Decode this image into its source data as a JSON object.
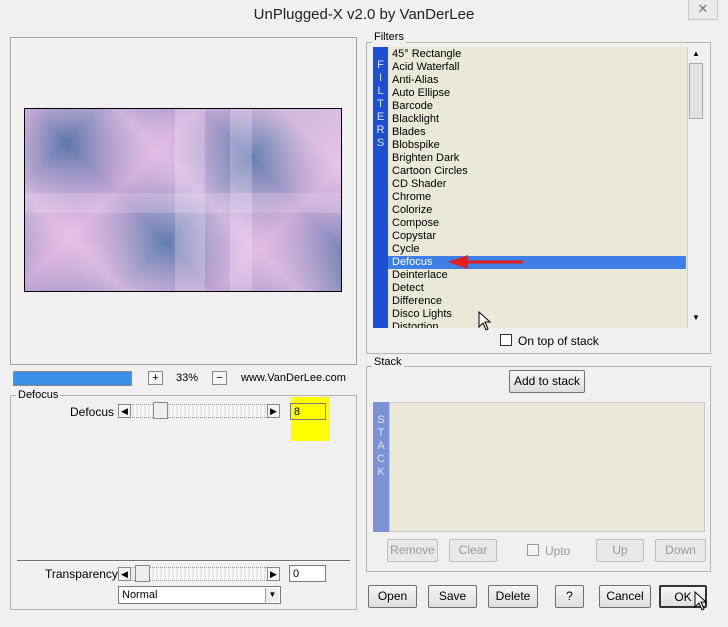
{
  "window": {
    "title": "UnPlugged-X v2.0 by VanDerLee",
    "close_glyph": "✕"
  },
  "preview": {
    "zoom_minus": "+",
    "zoom": "33%",
    "zoom_plus": "−",
    "website": "www.VanDerLee.com",
    "progress": 1.0
  },
  "defocus_group": {
    "label": "Defocus",
    "param_label": "Defocus",
    "value": "8",
    "slider_value": 8,
    "highlight_color": "#ffff00"
  },
  "transparency": {
    "label": "Transparency",
    "value": "0",
    "blend_mode": "Normal"
  },
  "filters": {
    "label": "Filters",
    "vertical_tag": [
      "F",
      "I",
      "L",
      "T",
      "E",
      "R",
      "S"
    ],
    "items": [
      "45° Rectangle",
      "Acid Waterfall",
      "Anti-Alias",
      "Auto Ellipse",
      "Barcode",
      "Blacklight",
      "Blades",
      "Blobspike",
      "Brighten Dark",
      "Cartoon Circles",
      "CD Shader",
      "Chrome",
      "Colorize",
      "Compose",
      "Copystar",
      "Cycle",
      "Defocus",
      "Deinterlace",
      "Detect",
      "Difference",
      "Disco Lights",
      "Distortion"
    ],
    "selected": "Defocus",
    "on_top_label": "On top of stack",
    "on_top_checked": false,
    "selection_color": "#3d7fe6",
    "tag_color": "#1f4fd1"
  },
  "stack": {
    "label": "Stack",
    "add_label": "Add to stack",
    "vertical_tag": [
      "S",
      "T",
      "A",
      "C",
      "K"
    ],
    "remove_label": "Remove",
    "clear_label": "Clear",
    "upto_label": "Upto",
    "up_label": "Up",
    "down_label": "Down",
    "tag_color": "#7b93d6"
  },
  "footer": {
    "open": "Open",
    "save": "Save",
    "delete": "Delete",
    "help": "?",
    "cancel": "Cancel",
    "ok": "OK"
  },
  "annotation": {
    "arrow_color": "#e31e1e"
  }
}
